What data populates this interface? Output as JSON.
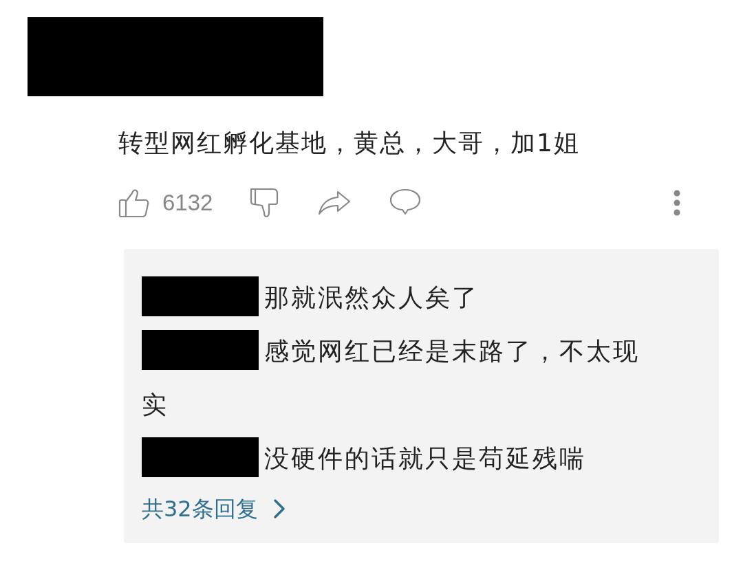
{
  "comment": {
    "author_redacted": true,
    "text": "转型网红孵化基地，黄总，大哥，加1姐",
    "likes": "6132"
  },
  "replies": [
    {
      "author_redacted": true,
      "text": "那就泯然众人矣了"
    },
    {
      "author_redacted": true,
      "text": "感觉网红已经是末路了，不太现实"
    },
    {
      "author_redacted": true,
      "text": "没硬件的话就只是苟延残喘"
    }
  ],
  "more_replies": "共32条回复"
}
